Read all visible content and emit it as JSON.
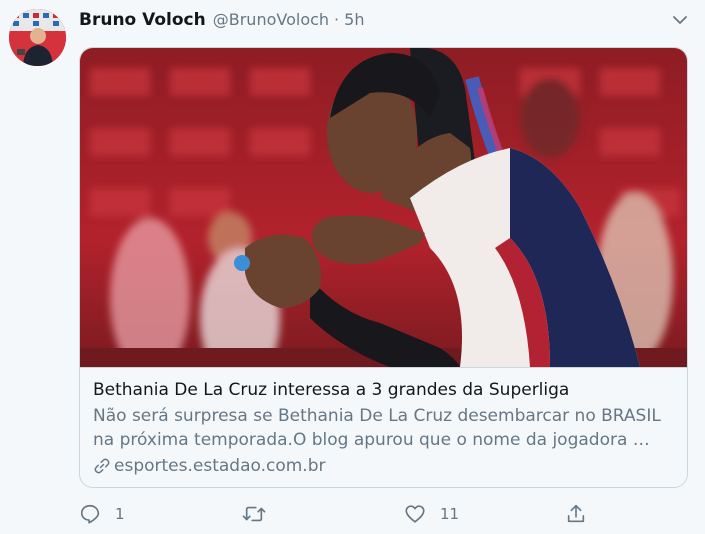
{
  "tweet": {
    "author_name": "Bruno Voloch",
    "author_handle": "@BrunoVoloch",
    "separator": "·",
    "time": "5h"
  },
  "card": {
    "title": "Bethania De La Cruz interessa a 3 grandes da Superliga",
    "description": "Não será surpresa se Bethania De La Cruz desembarcar no BRASIL\nna próxima temporada.O blog apurou que o nome da jogadora …",
    "domain": "esportes.estadao.com.br",
    "image_subject": "volleyball player in dark jersey with blue and red braided hair"
  },
  "actions": {
    "reply_count": "1",
    "retweet_count": "",
    "like_count": "11"
  },
  "icons": [
    "caret-down-icon",
    "link-icon",
    "reply-icon",
    "retweet-icon",
    "like-icon",
    "share-icon"
  ],
  "colors": {
    "icon": "#657786",
    "text": "#14171a",
    "muted": "#657786",
    "border": "#ccd6dd"
  }
}
